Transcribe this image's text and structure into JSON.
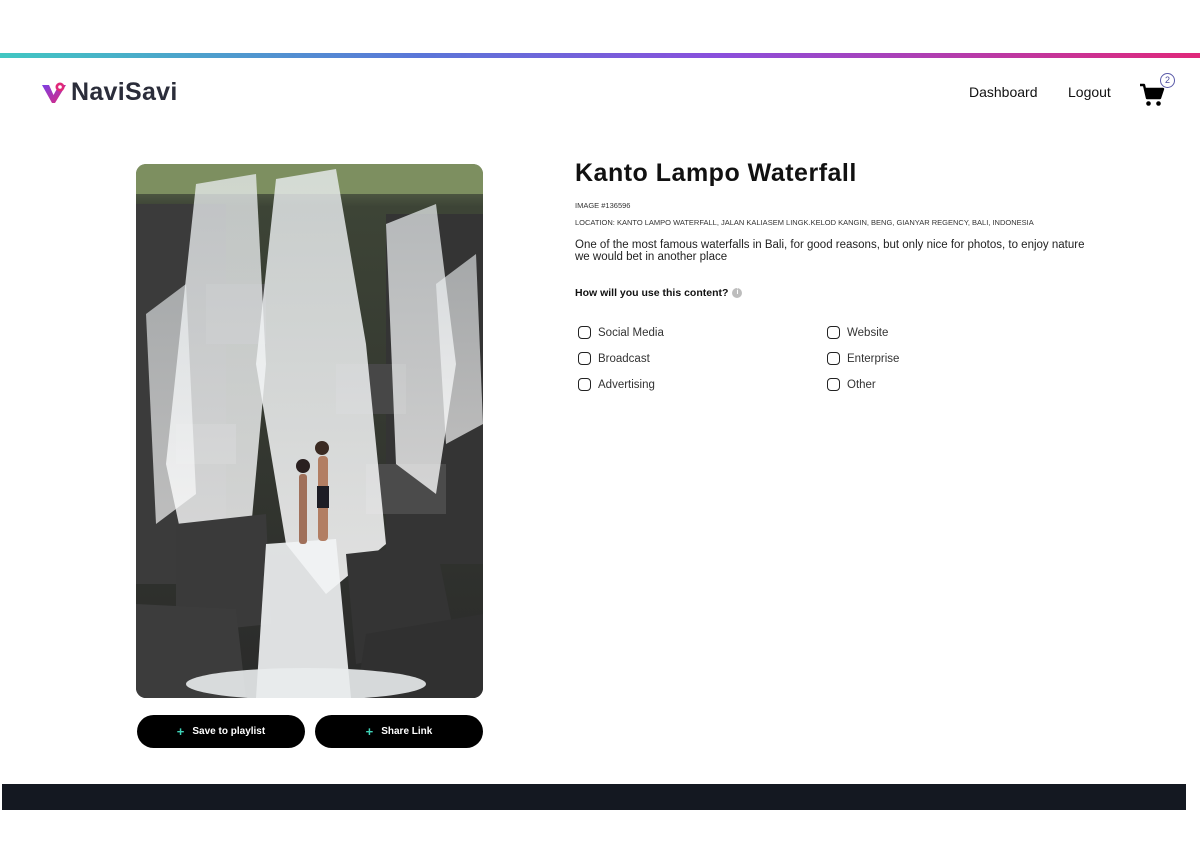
{
  "brand": {
    "name": "NaviSavi"
  },
  "nav": {
    "dashboard": "Dashboard",
    "logout": "Logout",
    "cart_count": "2"
  },
  "image": {
    "title": "Kanto Lampo Waterfall",
    "id_text": "IMAGE #136596",
    "location_text": "LOCATION: KANTO LAMPO WATERFALL, JALAN KALIASEM LINGK.KELOD KANGIN, BENG, GIANYAR REGENCY, BALI, INDONESIA",
    "description": "One of the most famous waterfalls in Bali, for good reasons, but only nice for photos, to enjoy nature we would bet in another place"
  },
  "actions": {
    "save_label": "Save to playlist",
    "share_label": "Share Link",
    "plus_icon": "+"
  },
  "usage": {
    "question": "How will you use this content?",
    "info_icon": "i",
    "options": [
      "Social Media",
      "Broadcast",
      "Advertising",
      "Website",
      "Enterprise",
      "Other"
    ]
  },
  "colors": {
    "accent_plus": "#3fd3b8",
    "footer": "#141821",
    "button": "#000000"
  }
}
